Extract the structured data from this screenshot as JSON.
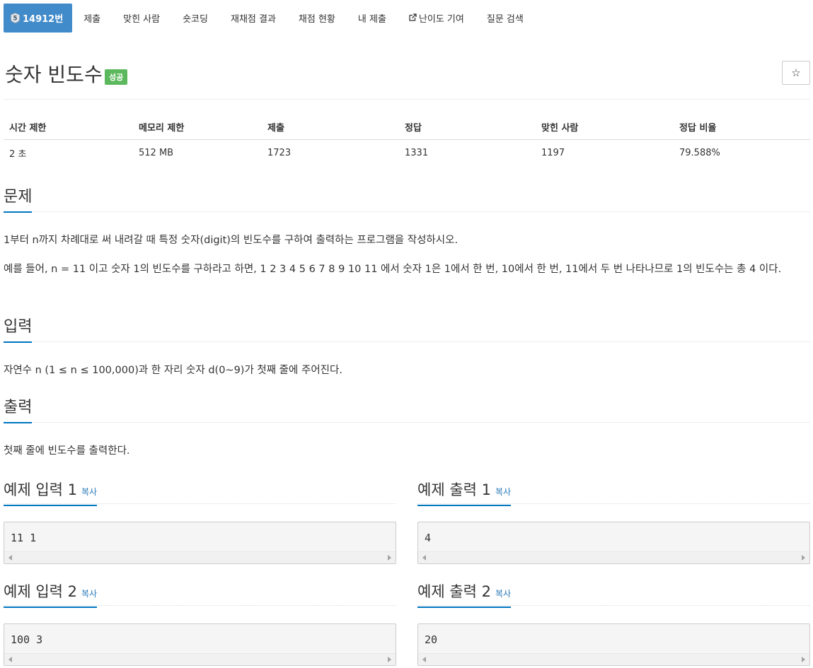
{
  "nav": {
    "tier": "5",
    "problem_number": "14912번",
    "items": [
      "제출",
      "맞힌 사람",
      "숏코딩",
      "재채점 결과",
      "채점 현황",
      "내 제출",
      "난이도 기여",
      "질문 검색"
    ]
  },
  "problem": {
    "title": "숫자 빈도수",
    "badge": "성공",
    "star": "☆"
  },
  "info_table": {
    "headers": [
      "시간 제한",
      "메모리 제한",
      "제출",
      "정답",
      "맞힌 사람",
      "정답 비율"
    ],
    "row": [
      "2 초",
      "512 MB",
      "1723",
      "1331",
      "1197",
      "79.588%"
    ]
  },
  "sections": {
    "problem_head": "문제",
    "problem_p1": "1부터 n까지 차례대로 써 내려갈 때 특정 숫자(digit)의 빈도수를 구하여 출력하는 프로그램을 작성하시오.",
    "problem_p2": "예를 들어, n = 11 이고 숫자 1의 빈도수를 구하라고 하면, 1 2 3 4 5 6 7 8 9 10 11 에서 숫자 1은 1에서 한 번, 10에서 한 번, 11에서 두 번 나타나므로 1의 빈도수는 총 4 이다.",
    "input_head": "입력",
    "input_p": "자연수 n (1 ≤ n ≤ 100,000)과 한 자리 숫자 d(0~9)가 첫째 줄에 주어진다.",
    "output_head": "출력",
    "output_p": "첫째 줄에 빈도수를 출력한다."
  },
  "samples": {
    "copy_label": "복사",
    "in1_title": "예제 입력 1",
    "out1_title": "예제 출력 1",
    "in2_title": "예제 입력 2",
    "out2_title": "예제 출력 2",
    "in1": "11 1",
    "out1": "4",
    "in2": "100 3",
    "out2": "20"
  },
  "colors": {
    "primary": "#428bca",
    "success": "#5cb85c",
    "underline": "#0076c0",
    "link": "#2a7ab8"
  }
}
